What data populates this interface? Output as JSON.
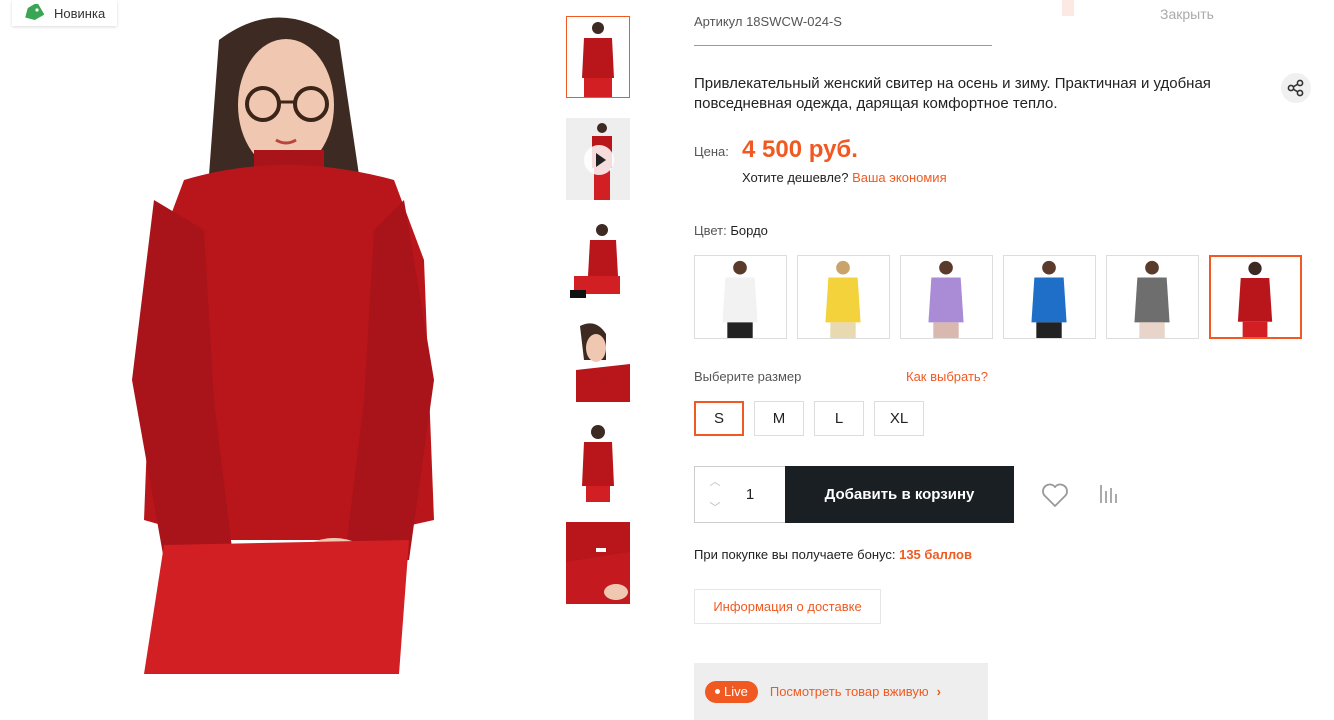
{
  "badge": {
    "label": "Новинка",
    "icon": "tag-icon"
  },
  "close": {
    "label": "Закрыть"
  },
  "product": {
    "sku": "Артикул 18SWCW-024-S",
    "description": "Привлекательный женский свитер на осень и зиму. Практичная и удобная повседневная одежда, дарящая комфортное тепло.",
    "price_label": "Цена:",
    "price": "4 500 руб.",
    "cheaper_text": "Хотите дешевле?",
    "cheaper_link": "Ваша экономия"
  },
  "color": {
    "label": "Цвет:",
    "selected": "Бордо",
    "swatches": [
      {
        "color": "#f2f2f2"
      },
      {
        "color": "#f3d23c"
      },
      {
        "color": "#a98bd6"
      },
      {
        "color": "#1f6fc9"
      },
      {
        "color": "#6e6e6e"
      },
      {
        "color": "#b8161b"
      }
    ]
  },
  "size": {
    "label": "Выберите размер",
    "guide": "Как выбрать?",
    "options": [
      "S",
      "M",
      "L",
      "XL"
    ],
    "selected": "S"
  },
  "cart": {
    "quantity": "1",
    "add_label": "Добавить в корзину"
  },
  "bonus": {
    "text": "При покупке вы получаете бонус:",
    "value": "135 баллов"
  },
  "delivery": {
    "label": "Информация о доставке"
  },
  "live": {
    "pill": "Live",
    "text": "Посмотреть товар вживую",
    "chevron": "›"
  },
  "theme": {
    "accent": "#f05a22",
    "dark": "#1a1f24",
    "sweater": "#b8161b"
  }
}
